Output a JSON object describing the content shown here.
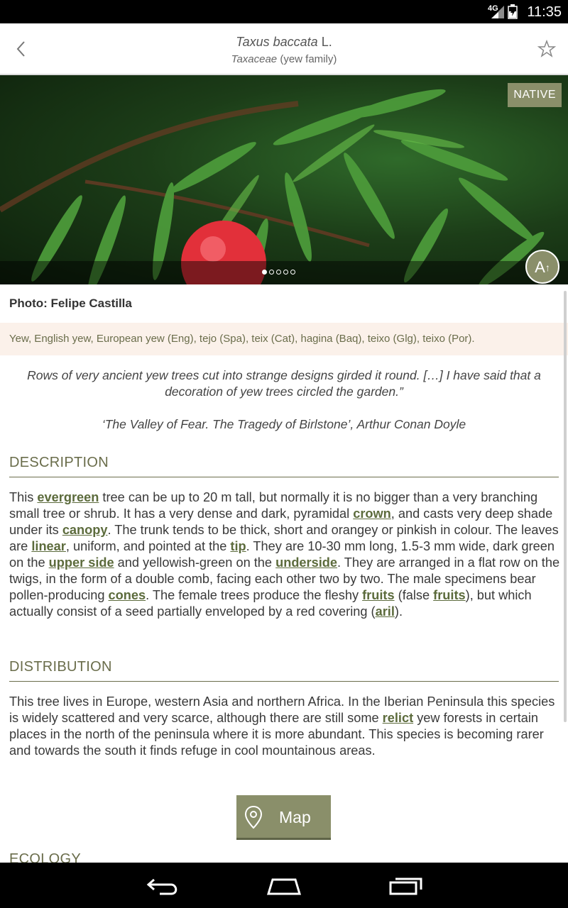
{
  "status_bar": {
    "network": "4G",
    "time": "11:35"
  },
  "app_bar": {
    "species_name": "Taxus baccata",
    "author": "L.",
    "family_latin": "Taxaceae",
    "family_common": "(yew family)"
  },
  "gallery": {
    "badge": "NATIVE",
    "dots_total": 5,
    "active_dot": 1,
    "font_button": "A"
  },
  "photo_credit": "Photo: Felipe Castilla",
  "common_names": "Yew, English yew, European yew (Eng), tejo (Spa), teix (Cat), hagina (Baq), teixo (Glg), teixo (Por).",
  "quote": {
    "text": "Rows of very ancient yew trees cut into strange designs girded it round. […] I have said that a decoration of yew trees circled the garden.”",
    "source": "‘The Valley of Fear. The Tragedy of Birlstone’, Arthur Conan Doyle"
  },
  "description": {
    "heading": "DESCRIPTION",
    "parts": [
      "This ",
      "evergreen",
      " tree can be up to 20 m tall, but normally it is no bigger than a very branching small tree or shrub. It has a very dense and dark, pyramidal ",
      "crown",
      ", and casts very deep shade under its ",
      "canopy",
      ". The trunk tends to be thick, short and orangey or pinkish in colour. The leaves are ",
      "linear",
      ", uniform, and pointed at the ",
      "tip",
      ". They are 10-30 mm long, 1.5-3 mm wide, dark green on the ",
      "upper side",
      " and yellowish-green on the ",
      "underside",
      ". They are arranged in a flat row on the twigs, in the form of a double comb, facing each other two by two. The male specimens bear pollen-producing ",
      "cones",
      ". The female trees produce the fleshy ",
      "fruits",
      " (false ",
      "fruits",
      "), but which actually consist of a seed partially enveloped by a red covering (",
      "aril",
      ")."
    ]
  },
  "distribution": {
    "heading": "DISTRIBUTION",
    "parts": [
      "This tree lives in Europe, western Asia and northern Africa. In the Iberian Peninsula this species is widely scattered and very scarce, although there are still some ",
      "relict",
      " yew forests in certain places in the north of the peninsula where it is more abundant. This species is becoming rarer and towards the south it finds refuge in cool mountainous areas."
    ]
  },
  "map_button": {
    "label": "Map"
  },
  "next_heading": "ECOLOGY",
  "colors": {
    "accent": "#8a8f6a",
    "link": "#5c6b3c",
    "names_bg": "#fbf1ea",
    "heading": "#6a6d4b"
  },
  "icons": {
    "back": "chevron-left-icon",
    "favorite": "star-outline-icon",
    "map": "map-pin-icon",
    "nav_back": "nav-back-icon",
    "nav_home": "nav-home-icon",
    "nav_recents": "nav-recents-icon"
  }
}
